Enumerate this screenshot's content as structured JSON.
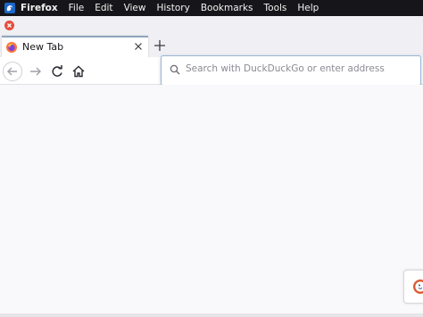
{
  "menubar": {
    "app_name": "Firefox",
    "items": [
      "File",
      "Edit",
      "View",
      "History",
      "Bookmarks",
      "Tools",
      "Help"
    ]
  },
  "tab": {
    "title": "New Tab"
  },
  "urlbar": {
    "placeholder": "Search with DuckDuckGo or enter address"
  },
  "icons": {
    "app": "firefox-icon",
    "close": "close-window-icon",
    "tab_favicon": "firefox-icon",
    "tab_close": "close-icon",
    "new_tab": "plus-icon",
    "back": "arrow-left-icon",
    "forward": "arrow-right-icon",
    "reload": "reload-icon",
    "home": "home-icon",
    "search": "search-icon",
    "ddg": "duckduckgo-icon"
  },
  "colors": {
    "menubar": "#16161a",
    "accent": "#8fa6be",
    "close": "#e74c3c",
    "ddg": "#de5833"
  }
}
